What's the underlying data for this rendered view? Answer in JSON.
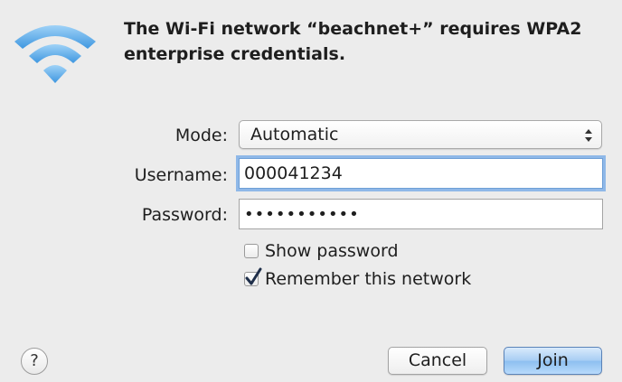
{
  "dialog": {
    "icon": "wifi-icon",
    "title": "The Wi-Fi network “beachnet+” requires WPA2 enterprise credentials."
  },
  "form": {
    "mode": {
      "label": "Mode:",
      "selected": "Automatic"
    },
    "username": {
      "label": "Username:",
      "value": "000041234"
    },
    "password": {
      "label": "Password:",
      "masked_value": "•••••••••••"
    },
    "show_password": {
      "label": "Show password",
      "checked": false
    },
    "remember_network": {
      "label": "Remember this network",
      "checked": true
    }
  },
  "footer": {
    "help_glyph": "?",
    "cancel_label": "Cancel",
    "join_label": "Join"
  },
  "colors": {
    "wifi_blue": "#4aa3e8",
    "focus_ring": "#8fb8e8",
    "default_button": "#a7cdf3"
  }
}
